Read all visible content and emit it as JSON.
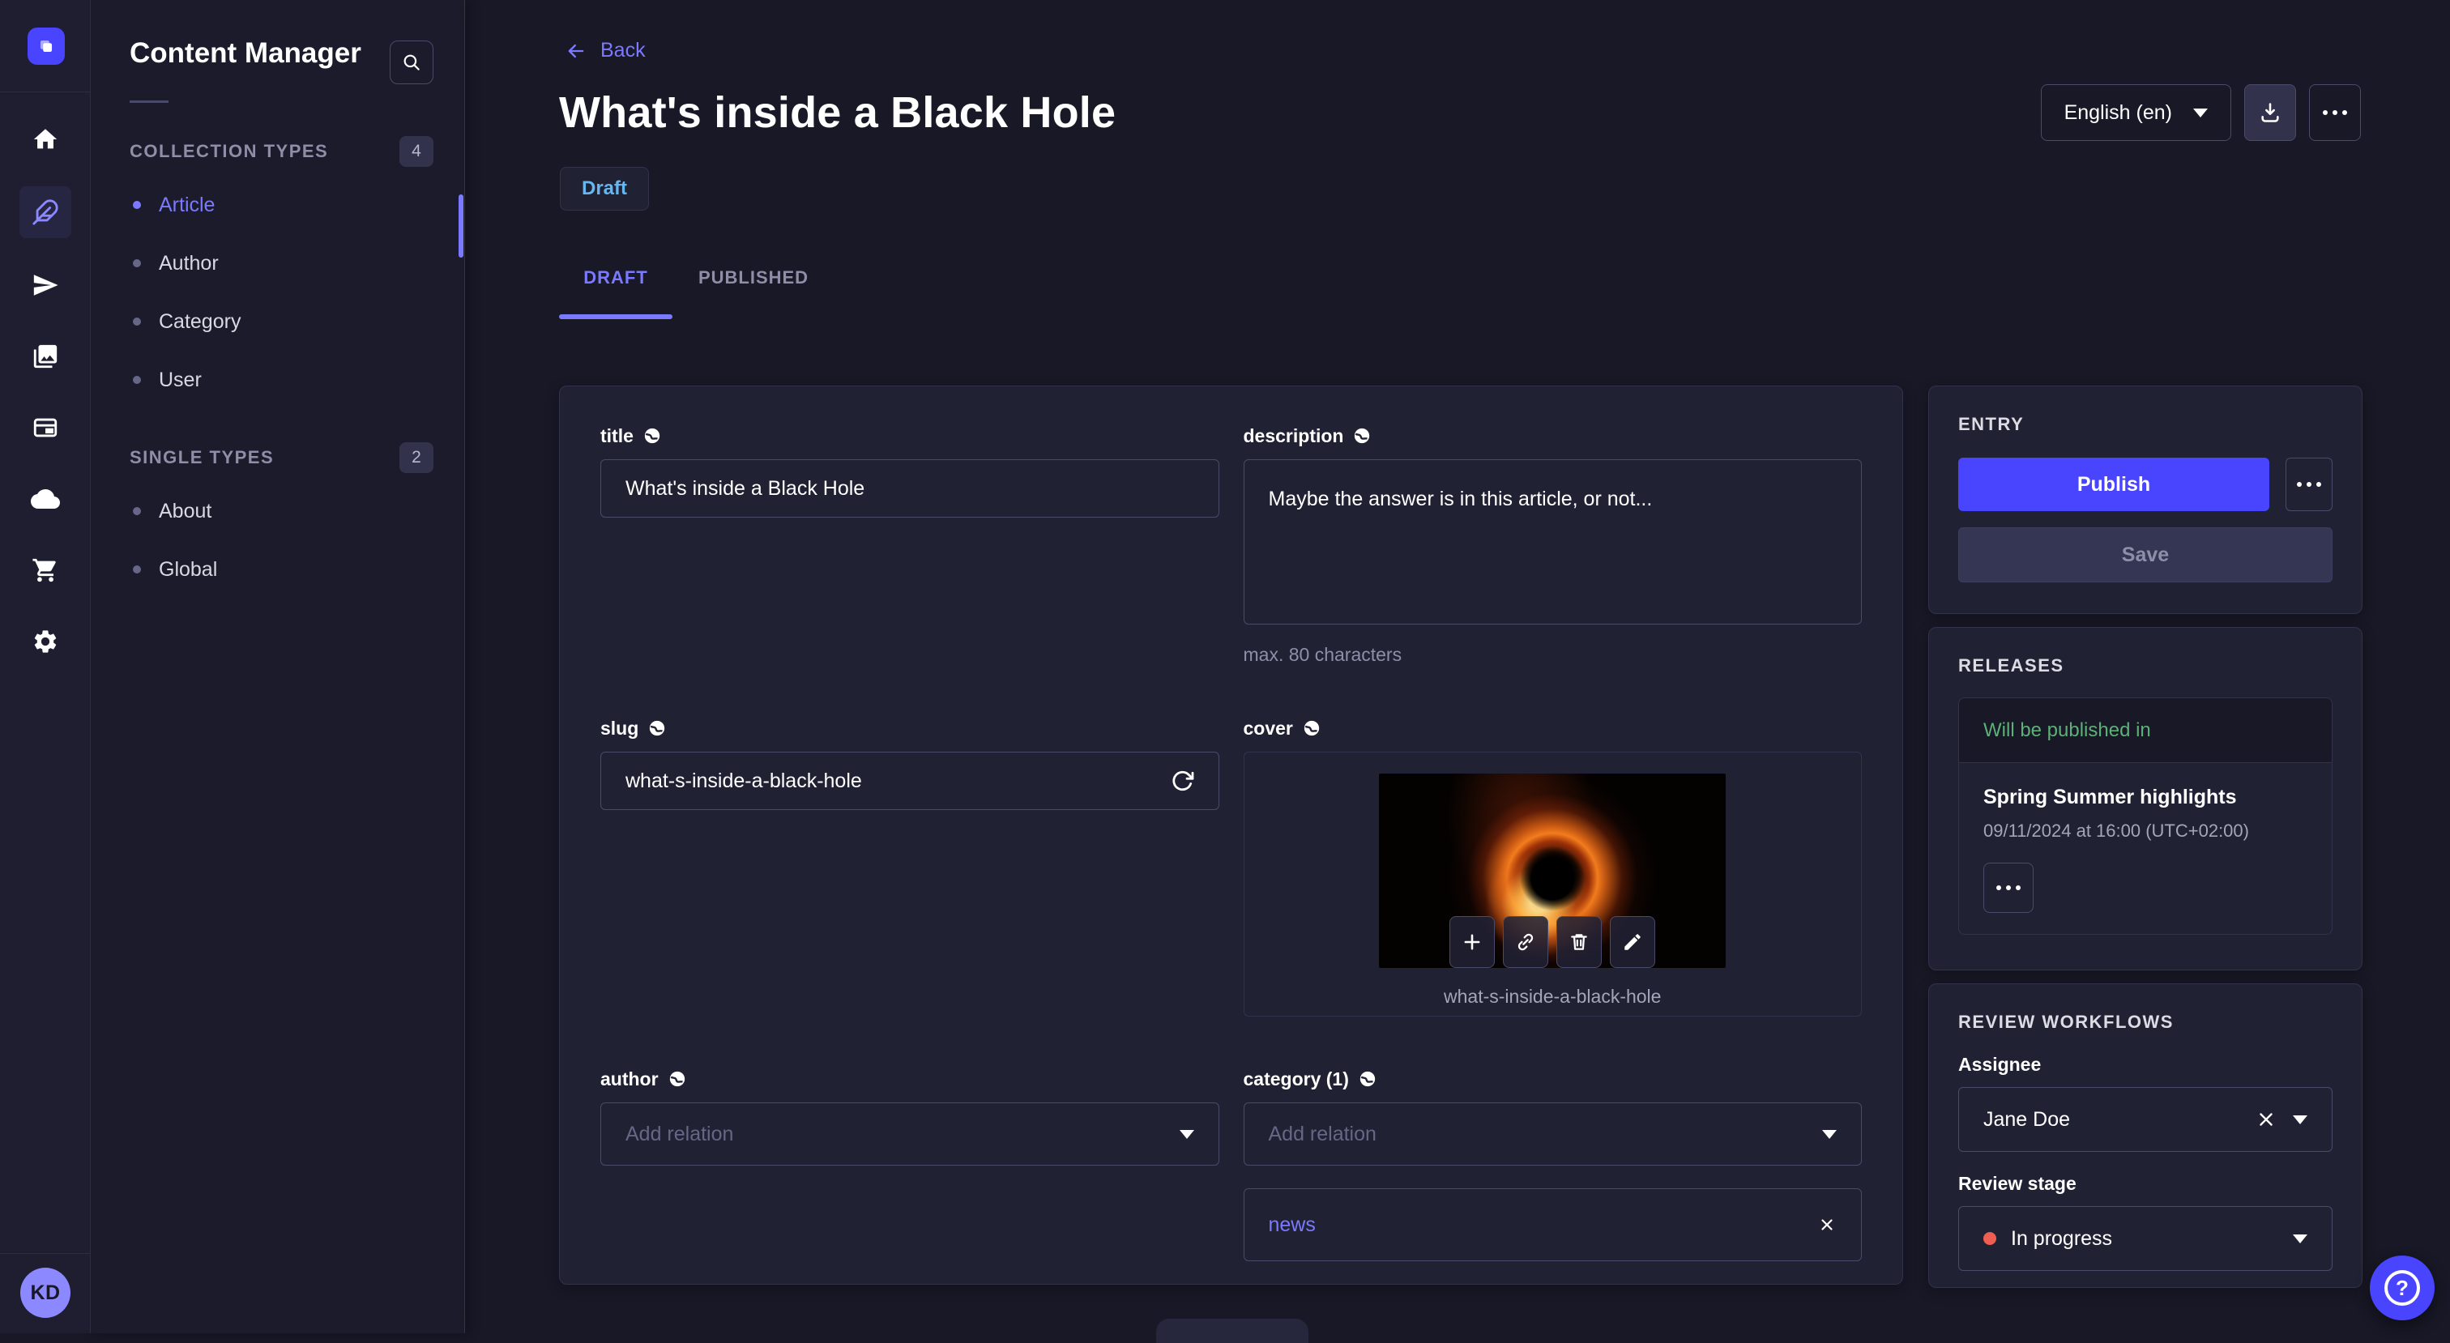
{
  "appnav": {
    "avatar_initials": "KD"
  },
  "subnav": {
    "title": "Content Manager",
    "sections": [
      {
        "label": "COLLECTION TYPES",
        "count": "4",
        "items": [
          {
            "label": "Article"
          },
          {
            "label": "Author"
          },
          {
            "label": "Category"
          },
          {
            "label": "User"
          }
        ]
      },
      {
        "label": "SINGLE TYPES",
        "count": "2",
        "items": [
          {
            "label": "About"
          },
          {
            "label": "Global"
          }
        ]
      }
    ]
  },
  "header": {
    "back_label": "Back",
    "title": "What's inside a Black Hole",
    "status_badge": "Draft",
    "locale": "English (en)",
    "tabs": {
      "draft": "DRAFT",
      "published": "PUBLISHED"
    }
  },
  "form": {
    "title_label": "title",
    "title_value": "What's inside a Black Hole",
    "description_label": "description",
    "description_value": "Maybe the answer is in this article, or not...",
    "description_hint": "max. 80 characters",
    "slug_label": "slug",
    "slug_value": "what-s-inside-a-black-hole",
    "cover_label": "cover",
    "cover_caption": "what-s-inside-a-black-hole",
    "author_label": "author",
    "author_placeholder": "Add relation",
    "category_label": "category (1)",
    "category_placeholder": "Add relation",
    "category_selected": "news"
  },
  "entry_panel": {
    "heading": "ENTRY",
    "publish_label": "Publish",
    "save_label": "Save"
  },
  "releases_panel": {
    "heading": "RELEASES",
    "status": "Will be published in",
    "release_name": "Spring Summer highlights",
    "release_date": "09/11/2024 at 16:00 (UTC+02:00)"
  },
  "review_panel": {
    "heading": "REVIEW WORKFLOWS",
    "assignee_label": "Assignee",
    "assignee_value": "Jane Doe",
    "stage_label": "Review stage",
    "stage_value": "In progress"
  },
  "colors": {
    "primary": "#4945ff",
    "primary_light": "#7b79ff",
    "draft_blue": "#66b7f1",
    "success_green": "#5cb176",
    "danger_red": "#ee5e52"
  }
}
